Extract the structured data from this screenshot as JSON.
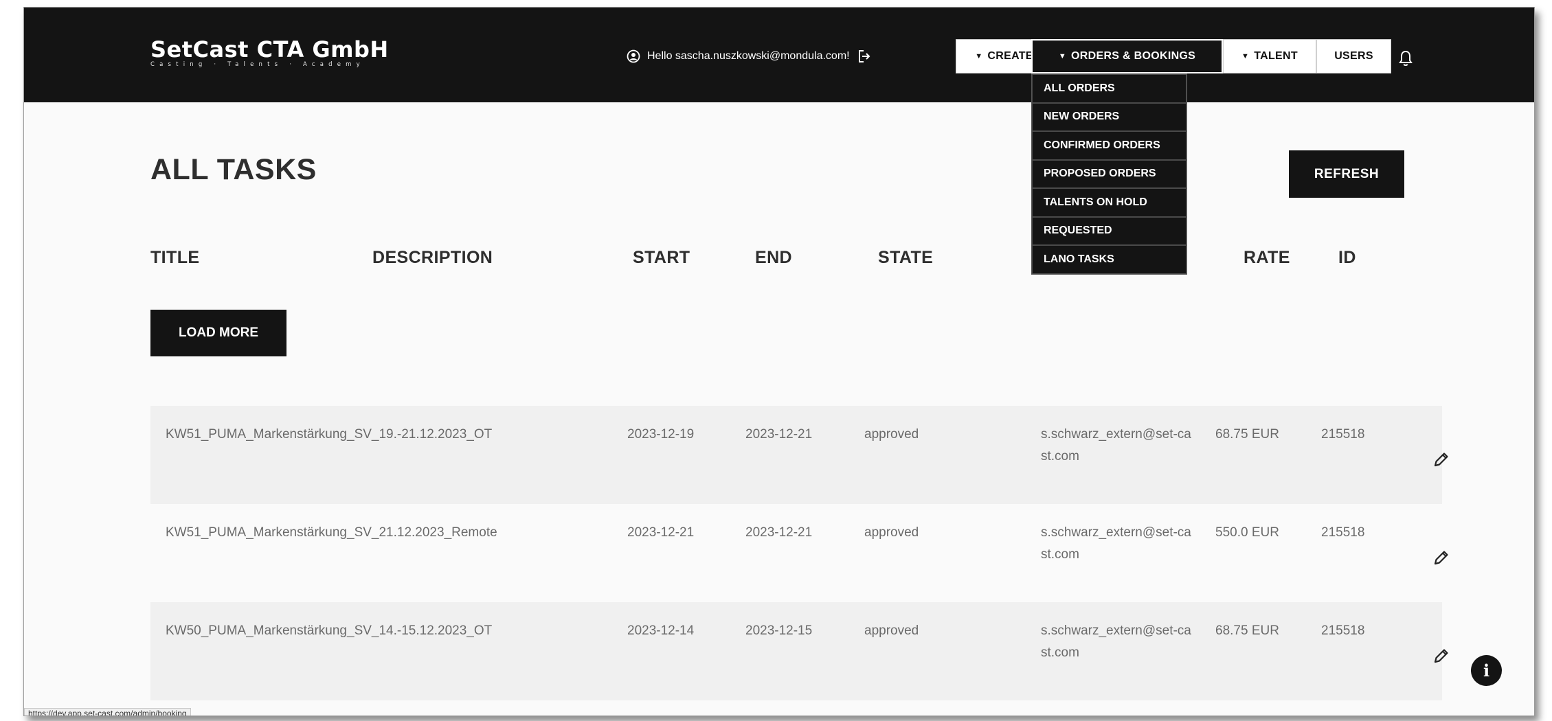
{
  "header": {
    "brand_name": "SetCast CTA GmbH",
    "brand_tagline": "Casting · Talents · Academy",
    "greeting": "Hello sascha.nuszkowski@mondula.com!"
  },
  "nav": {
    "create": "CREATE",
    "orders_bookings": "ORDERS & BOOKINGS",
    "talent": "TALENT",
    "users": "USERS"
  },
  "dropdown": {
    "items": [
      {
        "label": "ALL ORDERS"
      },
      {
        "label": "NEW ORDERS"
      },
      {
        "label": "CONFIRMED ORDERS"
      },
      {
        "label": "PROPOSED ORDERS"
      },
      {
        "label": "TALENTS ON HOLD"
      },
      {
        "label": "REQUESTED"
      },
      {
        "label": "LANO TASKS"
      }
    ]
  },
  "page": {
    "title": "ALL TASKS",
    "refresh": "REFRESH",
    "load_more": "LOAD MORE"
  },
  "table": {
    "columns": {
      "title": "TITLE",
      "description": "DESCRIPTION",
      "start": "START",
      "end": "END",
      "state": "STATE",
      "rate": "RATE",
      "id": "ID"
    },
    "rows": [
      {
        "title": "KW51_PUMA_Markenstärkung_SV_19.-21.12.2023_OT",
        "description": "",
        "start": "2023-12-19",
        "end": "2023-12-21",
        "state": "approved",
        "email": "s.schwarz_extern@set-cast.com",
        "rate": "68.75 EUR",
        "id": "215518"
      },
      {
        "title": "KW51_PUMA_Markenstärkung_SV_21.12.2023_Remote",
        "description": "",
        "start": "2023-12-21",
        "end": "2023-12-21",
        "state": "approved",
        "email": "s.schwarz_extern@set-cast.com",
        "rate": "550.0 EUR",
        "id": "215518"
      },
      {
        "title": "KW50_PUMA_Markenstärkung_SV_14.-15.12.2023_OT",
        "description": "",
        "start": "2023-12-14",
        "end": "2023-12-15",
        "state": "approved",
        "email": "s.schwarz_extern@set-cast.com",
        "rate": "68.75 EUR",
        "id": "215518"
      }
    ]
  },
  "info_button": "i",
  "status_bar": {
    "url": "https://dev.app.set-cast.com/admin/booking"
  },
  "colors": {
    "navbar": "#141414",
    "page_background": "#fafafa",
    "row_shade": "#f0f0f0",
    "text_dark": "#2e2e2e",
    "text_muted": "#6a6a6a"
  },
  "icons": {
    "user": "user-circle-icon",
    "logout": "logout-icon",
    "bell": "bell-icon",
    "edit": "pencil-icon",
    "info": "info-icon"
  }
}
